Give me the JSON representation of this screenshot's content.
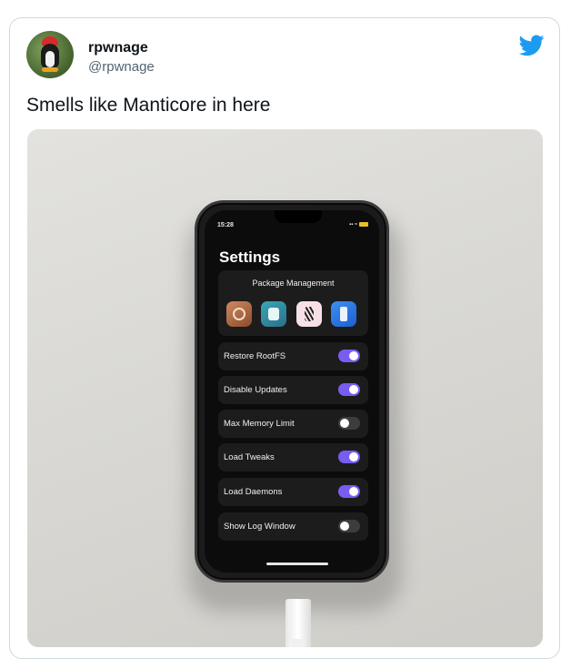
{
  "tweet": {
    "display_name": "rpwnage",
    "handle": "@rpwnage",
    "text": "Smells like Manticore in here",
    "brand_color": "#1d9bf0"
  },
  "phone_screen": {
    "status_time": "15:28",
    "title": "Settings",
    "package_management": {
      "label": "Package Management",
      "apps": [
        "cydia-icon",
        "sileo-icon",
        "zebra-icon",
        "installer-icon"
      ]
    },
    "settings": [
      {
        "label": "Restore RootFS",
        "state": "on"
      },
      {
        "label": "Disable Updates",
        "state": "on"
      },
      {
        "label": "Max Memory Limit",
        "state": "off"
      },
      {
        "label": "Load Tweaks",
        "state": "on"
      },
      {
        "label": "Load Daemons",
        "state": "on"
      },
      {
        "label": "Show Log Window",
        "state": "off"
      }
    ],
    "toggle_on_color": "#7a5cf0"
  }
}
